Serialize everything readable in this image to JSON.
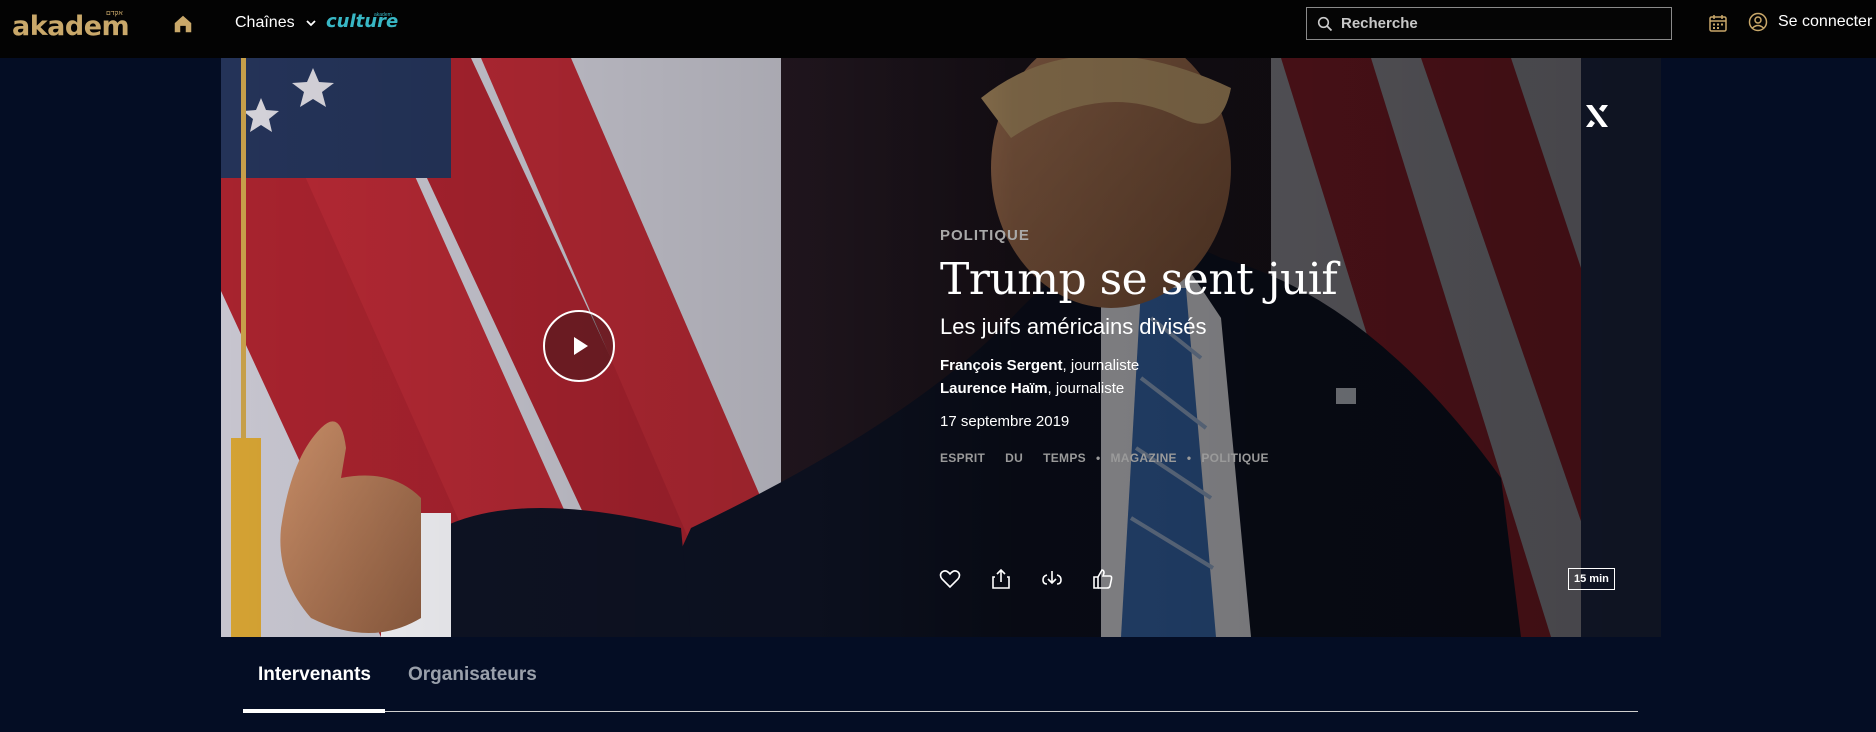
{
  "topbar": {
    "logo_text": "akadem",
    "logo_hebrew": "אקדם",
    "chaines_label": "Chaînes",
    "culture_label": "culture",
    "culture_sup": "akadem",
    "search_placeholder": "Recherche",
    "login_label": "Se connecter"
  },
  "hero": {
    "category": "POLITIQUE",
    "title": "Trump se sent juif",
    "subtitle": "Les juifs américains divisés",
    "speakers": [
      {
        "name": "François Sergent",
        "role": ", journaliste"
      },
      {
        "name": "Laurence Haïm",
        "role": ", journaliste"
      }
    ],
    "date": "17 septembre 2019",
    "tags": [
      "ESPRIT",
      "DU",
      "TEMPS",
      "MAGAZINE",
      "POLITIQUE"
    ],
    "tag_separators": [
      "",
      "",
      "•",
      "•"
    ],
    "duration": "15 min"
  },
  "tabs": {
    "items": [
      "Intervenants",
      "Organisateurs"
    ]
  },
  "colors": {
    "gold": "#c9a86a",
    "culture_teal": "#38b7c5",
    "page_bg": "#040d24"
  },
  "icons": [
    "home-icon",
    "chevron-down-icon",
    "search-icon",
    "calendar-icon",
    "user-circle-icon",
    "play-icon",
    "heart-icon",
    "share-icon",
    "download-icon",
    "thumbs-up-icon",
    "akadem-x-icon"
  ]
}
